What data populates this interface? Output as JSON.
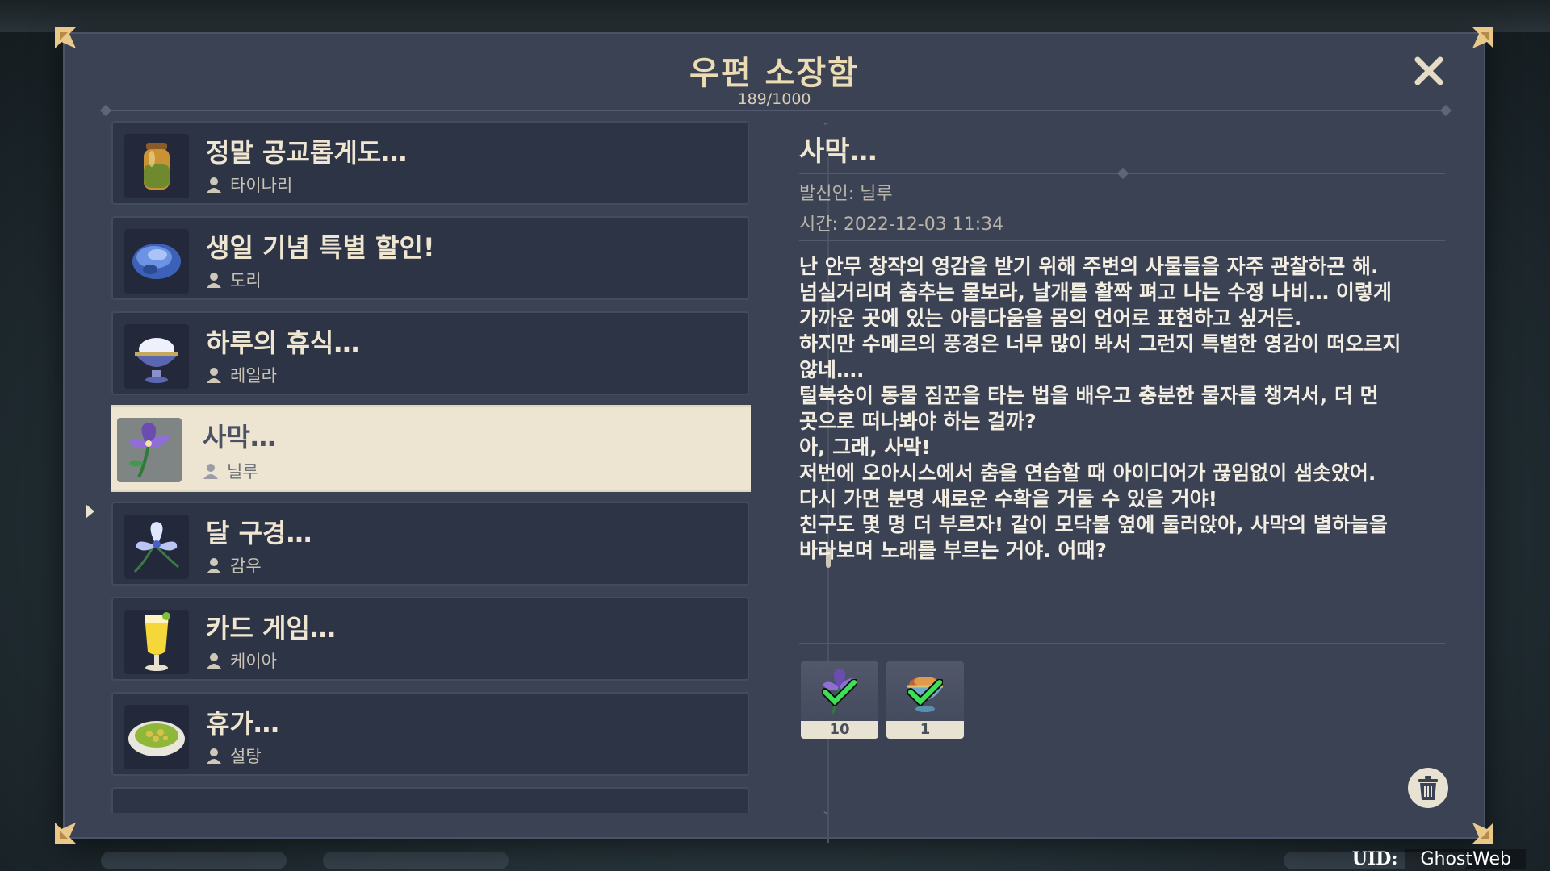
{
  "window": {
    "title": "우편 소장함",
    "count": "189/1000",
    "close_icon": "close-icon"
  },
  "mail_list": [
    {
      "subject": "정말 공교롭게도…",
      "sender": "타이나리",
      "icon": "spice-jar-icon",
      "selected": false
    },
    {
      "subject": "생일 기념 특별 할인!",
      "sender": "도리",
      "icon": "blue-mushroom-icon",
      "selected": false
    },
    {
      "subject": "하루의 휴식…",
      "sender": "레일라",
      "icon": "dessert-bowl-icon",
      "selected": false
    },
    {
      "subject": "사막…",
      "sender": "닐루",
      "icon": "padisarah-flower-icon",
      "selected": true
    },
    {
      "subject": "달 구경…",
      "sender": "감우",
      "icon": "qingxin-flower-icon",
      "selected": false
    },
    {
      "subject": "카드 게임…",
      "sender": "케이아",
      "icon": "cocktail-icon",
      "selected": false
    },
    {
      "subject": "휴가…",
      "sender": "설탕",
      "icon": "salad-plate-icon",
      "selected": false
    }
  ],
  "detail": {
    "title": "사막…",
    "sender": "발신인: 닐루",
    "time": "시간: 2022-12-03 11:34",
    "body_lines": [
      "난 안무 창작의 영감을 받기 위해 주변의 사물들을 자주 관찰하곤 해.",
      "넘실거리며 춤추는 물보라, 날개를 활짝 펴고 나는 수정 나비… 이렇게",
      "가까운 곳에 있는 아름다움을 몸의 언어로 표현하고 싶거든.",
      "하지만 수메르의 풍경은 너무 많이 봐서 그런지 특별한 영감이 떠오르지",
      "않네….",
      "털북숭이 동물 짐꾼을 타는 법을 배우고 충분한 물자를 챙겨서, 더 먼",
      "곳으로 떠나봐야 하는 걸까?",
      "아, 그래, 사막!",
      "저번에 오아시스에서 춤을 연습할 때 아이디어가 끊임없이 샘솟았어.",
      "다시 가면 분명 새로운 수확을 거둘 수 있을 거야!",
      "친구도 몇 명 더 부르자! 같이 모닥불 옆에 둘러앉아, 사막의 별하늘을",
      "바라보며 노래를 부르는 거야. 어때?"
    ],
    "rewards": [
      {
        "icon": "padisarah-flower-icon",
        "count": "10",
        "claimed": true
      },
      {
        "icon": "dish-bowl-icon",
        "count": "1",
        "claimed": true
      }
    ],
    "delete_icon": "trash-icon"
  },
  "footer": {
    "uid_label": "UID:",
    "uid_value": "GhostWeb"
  },
  "colors": {
    "panel": "#3b4254",
    "title_gold": "#ecdcb4",
    "item_bg": "#2c3445",
    "selected_bg": "#ede5d2",
    "check_green": "#3ee05a"
  }
}
